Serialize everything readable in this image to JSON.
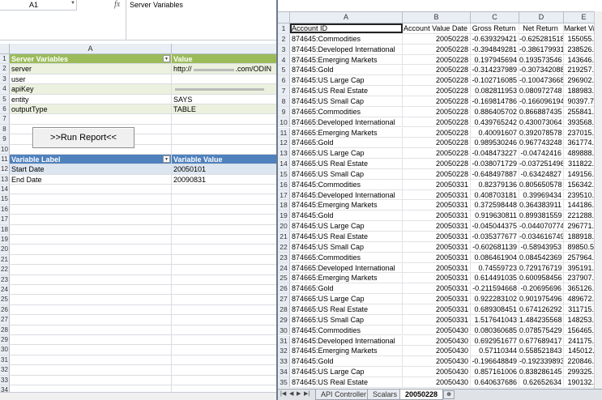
{
  "left": {
    "name_box": "A1",
    "formula": "Server Variables",
    "column_a": "A",
    "config_rows": [
      {
        "label": "Server Variables",
        "value": "Value"
      },
      {
        "label": "server",
        "value": "http://",
        "value_suffix": ".com/ODIN"
      },
      {
        "label": "user",
        "value": ""
      },
      {
        "label": "apiKey",
        "value": ""
      },
      {
        "label": "entity",
        "value": "SAYS"
      },
      {
        "label": "outputType",
        "value": "TABLE"
      }
    ],
    "run_button": ">>Run Report<<",
    "variable_header": {
      "label": "Variable Label",
      "value": "Variable Value"
    },
    "variables": [
      {
        "label": "Start Date",
        "value": "20050101"
      },
      {
        "label": "End Date",
        "value": "20090831"
      }
    ],
    "row_numbers": [
      "1",
      "2",
      "3",
      "4",
      "5",
      "6",
      "7",
      "8",
      "9",
      "10",
      "11",
      "12",
      "13",
      "14",
      "15",
      "16",
      "17",
      "18",
      "19",
      "20",
      "21",
      "22",
      "23",
      "24",
      "25",
      "26",
      "27",
      "28",
      "29",
      "30",
      "31",
      "32",
      "33",
      "34"
    ]
  },
  "right": {
    "columns": [
      "A",
      "B",
      "C",
      "D",
      "E"
    ],
    "header": [
      "Account ID",
      "Account Value Date",
      "Gross Return",
      "Net Return",
      "Market Value"
    ],
    "rows": [
      [
        "874645:Commodities",
        "20050228",
        "-0.639329421",
        "-0.625281518",
        "155055.15"
      ],
      [
        "874645:Developed International",
        "20050228",
        "-0.394849281",
        "-0.386179931",
        "238526.18"
      ],
      [
        "874645:Emerging Markets",
        "20050228",
        "0.197945694",
        "0.193573546",
        "143646.05"
      ],
      [
        "874645:Gold",
        "20050228",
        "-0.314237989",
        "-0.307342088",
        "219257.00"
      ],
      [
        "874645:US Large Cap",
        "20050228",
        "-0.102716085",
        "-0.100473668",
        "296902.27"
      ],
      [
        "874645:US Real Estate",
        "20050228",
        "0.082811953",
        "0.080972748",
        "188983.44"
      ],
      [
        "874645:US Small Cap",
        "20050228",
        "-0.169814786",
        "-0.166096194",
        "90397.701"
      ],
      [
        "874665:Commodities",
        "20050228",
        "0.886405702",
        "0.866887435",
        "255841.00"
      ],
      [
        "874665:Developed International",
        "20050228",
        "0.439765242",
        "0.430073064",
        "393568.19"
      ],
      [
        "874665:Emerging Markets",
        "20050228",
        "0.40091607",
        "0.392078578",
        "237015.99"
      ],
      [
        "874665:Gold",
        "20050228",
        "0.989530246",
        "0.967743248",
        "361774.06"
      ],
      [
        "874665:US Large Cap",
        "20050228",
        "-0.048473227",
        "-0.04742416",
        "489888.75"
      ],
      [
        "874665:US Real Estate",
        "20050228",
        "-0.038071729",
        "-0.037251496",
        "311822.67"
      ],
      [
        "874665:US Small Cap",
        "20050228",
        "-0.648497887",
        "-0.63424827",
        "149156.20"
      ],
      [
        "874645:Commodities",
        "20050331",
        "0.82379136",
        "0.805650578",
        "156342.37"
      ],
      [
        "874645:Developed International",
        "20050331",
        "0.408703181",
        "0.39969434",
        "239510.01"
      ],
      [
        "874645:Emerging Markets",
        "20050331",
        "0.372598448",
        "0.364383911",
        "144186.35"
      ],
      [
        "874645:Gold",
        "20050331",
        "0.919630811",
        "0.899381559",
        "221288.67"
      ],
      [
        "874645:US Large Cap",
        "20050331",
        "-0.045044375",
        "-0.044070774",
        "296771.21"
      ],
      [
        "874645:US Real Estate",
        "20050331",
        "-0.035377677",
        "-0.034616749",
        "188918.40"
      ],
      [
        "874645:US Small Cap",
        "20050331",
        "-0.602681139",
        "-0.58943953",
        "89850.531"
      ],
      [
        "874665:Commodities",
        "20050331",
        "0.086461904",
        "0.084542369",
        "257964.91"
      ],
      [
        "874665:Developed International",
        "20050331",
        "0.74559723",
        "0.729176719",
        "395191.53"
      ],
      [
        "874665:Emerging Markets",
        "20050331",
        "0.614491035",
        "0.600958456",
        "237907.48"
      ],
      [
        "874665:Gold",
        "20050331",
        "-0.211594668",
        "-0.20695696",
        "365126.31"
      ],
      [
        "874665:US Large Cap",
        "20050331",
        "0.922283102",
        "0.901975496",
        "489672.50"
      ],
      [
        "874665:US Real Estate",
        "20050331",
        "0.689308451",
        "0.674126292",
        "311715.36"
      ],
      [
        "874665:US Small Cap",
        "20050331",
        "1.517641043",
        "1.484235568",
        "148253.37"
      ],
      [
        "874645:Commodities",
        "20050430",
        "0.080360685",
        "0.078575429",
        "156465.71"
      ],
      [
        "874645:Developed International",
        "20050430",
        "0.692951677",
        "0.677689417",
        "241175.36"
      ],
      [
        "874645:Emerging Markets",
        "20050430",
        "0.57110344",
        "0.558521843",
        "145012.11"
      ],
      [
        "874645:Gold",
        "20050430",
        "-0.196648849",
        "-0.192339893",
        "220846.42"
      ],
      [
        "874645:US Large Cap",
        "20050430",
        "0.857161006",
        "0.838286145",
        "299325.07"
      ],
      [
        "874645:US Real Estate",
        "20050430",
        "0.640637686",
        "0.62652634",
        "190132.52"
      ]
    ],
    "tabs": [
      "API Controller",
      "Scalars",
      "20050228"
    ],
    "active_tab": "20050228"
  }
}
